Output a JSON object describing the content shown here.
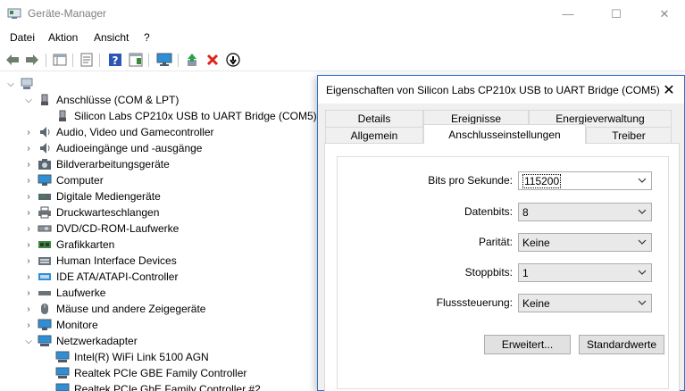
{
  "window": {
    "title": "Geräte-Manager",
    "minimize_glyph": "—",
    "maximize_glyph": "☐",
    "close_glyph": "✕"
  },
  "menu": {
    "items": [
      "Datei",
      "Aktion",
      "Ansicht",
      "?"
    ]
  },
  "toolbar": {
    "icons": [
      "back-arrow-icon",
      "forward-arrow-icon",
      "show-hide-console-tree-icon",
      "properties-icon",
      "help-icon",
      "action-pane-icon",
      "monitor-icon",
      "update-driver-icon",
      "uninstall-icon",
      "disable-device-icon"
    ]
  },
  "tree": {
    "rows": [
      {
        "label": "",
        "level": 0,
        "expanded": true,
        "icon": "computer-root-icon"
      },
      {
        "label": "Anschlüsse (COM & LPT)",
        "level": 1,
        "expanded": true,
        "icon": "port-icon"
      },
      {
        "label": "Silicon Labs CP210x USB to UART Bridge (COM5)",
        "level": 2,
        "icon": "port-icon"
      },
      {
        "label": "Audio, Video und Gamecontroller",
        "level": 1,
        "expanded": false,
        "icon": "speaker-icon"
      },
      {
        "label": "Audioeingänge und -ausgänge",
        "level": 1,
        "expanded": false,
        "icon": "speaker-icon"
      },
      {
        "label": "Bildverarbeitungsgeräte",
        "level": 1,
        "expanded": false,
        "icon": "camera-icon"
      },
      {
        "label": "Computer",
        "level": 1,
        "expanded": false,
        "icon": "computer-icon"
      },
      {
        "label": "Digitale Mediengeräte",
        "level": 1,
        "expanded": false,
        "icon": "media-device-icon"
      },
      {
        "label": "Druckwarteschlangen",
        "level": 1,
        "expanded": false,
        "icon": "printer-icon"
      },
      {
        "label": "DVD/CD-ROM-Laufwerke",
        "level": 1,
        "expanded": false,
        "icon": "dvd-icon"
      },
      {
        "label": "Grafikkarten",
        "level": 1,
        "expanded": false,
        "icon": "graphics-card-icon"
      },
      {
        "label": "Human Interface Devices",
        "level": 1,
        "expanded": false,
        "icon": "hid-icon"
      },
      {
        "label": "IDE ATA/ATAPI-Controller",
        "level": 1,
        "expanded": false,
        "icon": "ide-controller-icon"
      },
      {
        "label": "Laufwerke",
        "level": 1,
        "expanded": false,
        "icon": "disk-drive-icon"
      },
      {
        "label": "Mäuse und andere Zeigegeräte",
        "level": 1,
        "expanded": false,
        "icon": "mouse-icon"
      },
      {
        "label": "Monitore",
        "level": 1,
        "expanded": false,
        "icon": "monitor-icon"
      },
      {
        "label": "Netzwerkadapter",
        "level": 1,
        "expanded": true,
        "icon": "network-adapter-icon"
      },
      {
        "label": "Intel(R) WiFi Link 5100 AGN",
        "level": 2,
        "icon": "network-adapter-icon"
      },
      {
        "label": "Realtek PCIe GBE Family Controller",
        "level": 2,
        "icon": "network-adapter-icon"
      },
      {
        "label": "Realtek PCIe GbE Family Controller #2",
        "level": 2,
        "icon": "network-adapter-icon"
      }
    ]
  },
  "dialog": {
    "title": "Eigenschaften von Silicon Labs CP210x USB to UART Bridge (COM5)",
    "close_glyph": "✕",
    "tabs_back": [
      "Details",
      "Ereignisse",
      "Energieverwaltung"
    ],
    "tabs_front": [
      "Allgemein",
      "Anschlusseinstellungen",
      "Treiber"
    ],
    "active_tab": "Anschlusseinstellungen",
    "fields": [
      {
        "label": "Bits pro Sekunde:",
        "value": "115200",
        "focused": true
      },
      {
        "label": "Datenbits:",
        "value": "8"
      },
      {
        "label": "Parität:",
        "value": "Keine"
      },
      {
        "label": "Stoppbits:",
        "value": "1"
      },
      {
        "label": "Flusssteuerung:",
        "value": "Keine"
      }
    ],
    "buttons": {
      "advanced": "Erweitert...",
      "defaults": "Standardwerte"
    }
  },
  "colors": {
    "dialog_border": "#2f74c7",
    "monitor_blue": "#2f8fd6",
    "uninstall_red": "#e0201b",
    "update_green": "#2aa44a"
  }
}
